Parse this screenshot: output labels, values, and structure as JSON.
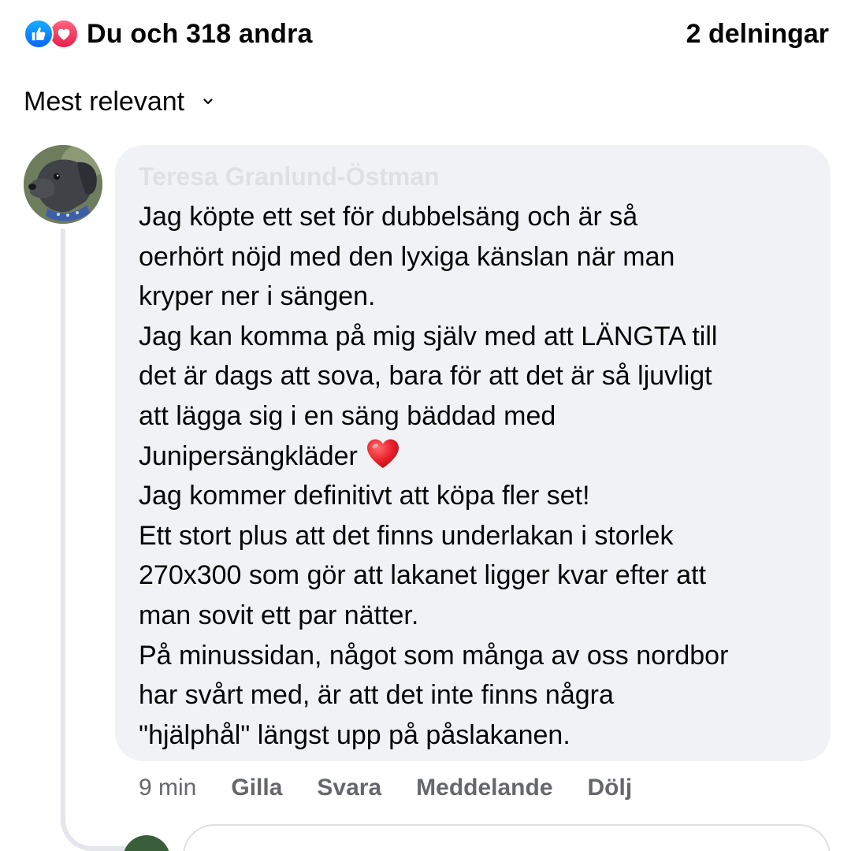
{
  "summary": {
    "reactions_text": "Du och 318 andra",
    "reaction_icons": [
      "like-icon",
      "love-icon"
    ],
    "shares_text": "2 delningar"
  },
  "sort": {
    "label": "Mest relevant",
    "icon": "chevron-down-icon"
  },
  "comment": {
    "author": "Teresa Granlund-Östman",
    "avatar": "dog-avatar",
    "lines": [
      "Jag köpte ett set för dubbelsäng och är så",
      "oerhört nöjd med den lyxiga känslan när man",
      "kryper ner i sängen.",
      "Jag kan komma på mig själv med att LÄNGTA till",
      "det är dags att sova, bara för att det är så ljuvligt",
      "att lägga sig i en säng bäddad med",
      "Junipersängkläder",
      "Jag kommer definitivt att köpa fler set!",
      "Ett stort plus att det finns underlakan i storlek",
      "270x300 som gör att lakanet ligger kvar efter att",
      "man sovit ett par nätter.",
      "På minussidan, något som många av oss nordbor",
      "har svårt med, är att det inte finns några",
      "\"hjälphål\" längst upp på påslakanen."
    ],
    "emoji": "red-heart-emoji",
    "timestamp": "9 min",
    "actions": {
      "like": "Gilla",
      "reply": "Svara",
      "message": "Meddelande",
      "hide": "Dölj"
    }
  },
  "colors": {
    "bubble_bg": "#f0f2f5",
    "secondary_text": "#65676b",
    "like_blue": "#0866ff",
    "love_red": "#e61e4d"
  }
}
